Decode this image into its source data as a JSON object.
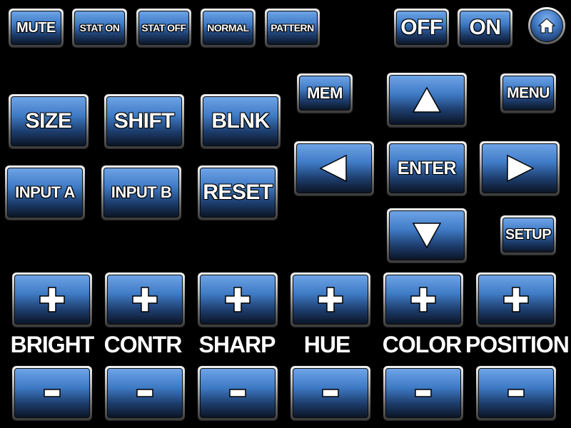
{
  "top_row": {
    "mute": "MUTE",
    "stat_on": "STAT ON",
    "stat_off": "STAT OFF",
    "normal": "NORMAL",
    "pattern": "PATTERN",
    "off": "OFF",
    "on": "ON"
  },
  "home": {
    "icon": "home-icon"
  },
  "left_block": {
    "size": "SIZE",
    "shift": "SHIFT",
    "blnk": "BLNK",
    "input_a": "INPUT A",
    "input_b": "INPUT B",
    "reset": "RESET"
  },
  "nav": {
    "mem": "MEM",
    "menu": "MENU",
    "enter": "ENTER",
    "setup": "SETUP",
    "up_icon": "up-arrow-icon",
    "down_icon": "down-arrow-icon",
    "left_icon": "left-arrow-icon",
    "right_icon": "right-arrow-icon"
  },
  "adjust": {
    "labels": [
      "BRIGHT",
      "CONTR",
      "SHARP",
      "HUE",
      "COLOR",
      "POSITION"
    ],
    "plus_icon": "plus-icon",
    "minus_icon": "minus-icon"
  },
  "colors": {
    "background": "#000000",
    "button_face": "#3f7bc6",
    "text": "#ffffff"
  }
}
